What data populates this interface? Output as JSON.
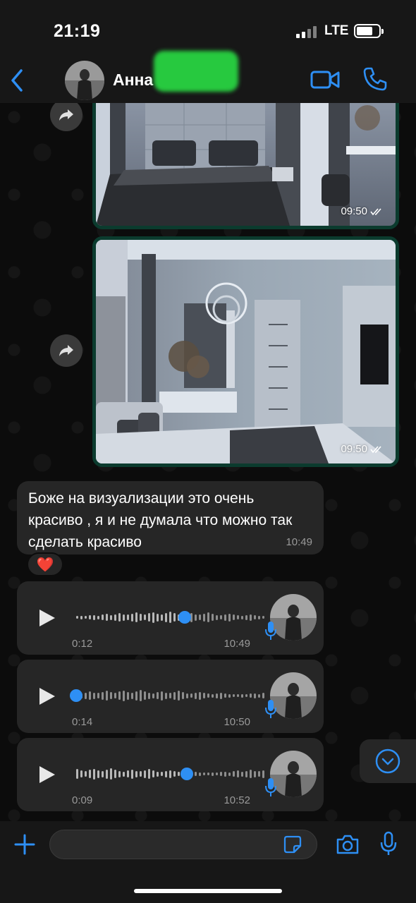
{
  "status_bar": {
    "time": "21:19",
    "network": "LTE"
  },
  "header": {
    "contact_name": "Анна L",
    "icons": [
      "back-icon",
      "video-call-icon",
      "phone-icon"
    ]
  },
  "messages": {
    "images": [
      {
        "time": "09:50"
      },
      {
        "time": "09:50"
      }
    ],
    "text_message": {
      "text": "Боже на визуализации это очень красиво , я и не думала что можно так сделать красиво",
      "time": "10:49",
      "reaction": "❤️"
    },
    "voice_messages": [
      {
        "duration": "0:12",
        "time": "10:49",
        "progress": 0.57
      },
      {
        "duration": "0:14",
        "time": "10:50",
        "progress": 0.0
      },
      {
        "duration": "0:09",
        "time": "10:52",
        "progress": 0.58
      }
    ]
  },
  "input": {
    "placeholder": ""
  },
  "colors": {
    "accent": "#2e8ff4",
    "bubble": "#262626",
    "outgoing_border": "#0b3b2e",
    "background": "#0c0c0c"
  }
}
